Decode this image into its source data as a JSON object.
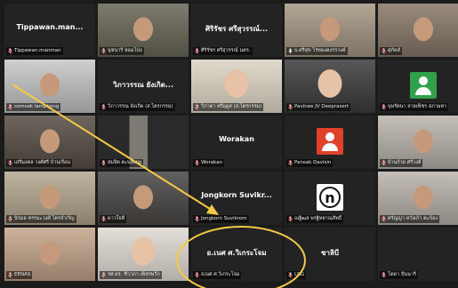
{
  "meeting": {
    "tiles": [
      {
        "row": 0,
        "col": 0,
        "center": "Tippawan.man...",
        "label": "Tippawan.manman",
        "mic": "muted",
        "bg": "#232323"
      },
      {
        "row": 0,
        "col": 1,
        "center": "",
        "label": "นุชนารี หอมโป่ง",
        "mic": "muted",
        "bg": "#6b6a5a",
        "video": "video"
      },
      {
        "row": 0,
        "col": 2,
        "center": "ศิริรัชร ศรีสุวรรณ์...",
        "label": "ศิริรัชร ศรีสุวรรณ์ นตร.",
        "mic": "muted",
        "bg": "#232323"
      },
      {
        "row": 0,
        "col": 3,
        "center": "",
        "label": "บ.ศรีสุข ไร่ทองคงรรวงค์",
        "mic": "on",
        "bg": "#a89a86",
        "video": "video",
        "active": true
      },
      {
        "row": 0,
        "col": 4,
        "center": "",
        "label": "ศุภิตส์",
        "mic": "muted",
        "bg": "#8a7b6c",
        "video": "video"
      },
      {
        "row": 1,
        "col": 0,
        "center": "",
        "label": "somsak lamphong",
        "mic": "muted",
        "bg": "#c9c9c9",
        "video": "video"
      },
      {
        "row": 1,
        "col": 1,
        "center": "วิภาวรรณ ยังเกิด...",
        "label": "วิภาวรรณ ยังเกิด (ส.ไตรกรรม)",
        "mic": "muted",
        "bg": "#232323"
      },
      {
        "row": 1,
        "col": 2,
        "center": "",
        "label": "วิภาดา ศรีอุดูส (ส.ไตรกรรม)",
        "mic": "muted",
        "bg": "#dcd4c4",
        "video": "photo"
      },
      {
        "row": 1,
        "col": 3,
        "center": "",
        "label": "Pavinee JV Deeprasert",
        "mic": "muted",
        "bg": "#3b3a3a",
        "video": "photo"
      },
      {
        "row": 1,
        "col": 4,
        "center": "",
        "label": "บุษรัตนา สายเพ็ชร สภามหา",
        "mic": "muted",
        "bg": "#232323",
        "avatar": "#2fa14a"
      },
      {
        "row": 2,
        "col": 0,
        "center": "",
        "label": "เสรีมงคล วงศ์ศรี บ้านเรือน",
        "mic": "muted",
        "bg": "#5a5148",
        "video": "video"
      },
      {
        "row": 2,
        "col": 1,
        "center": "",
        "label": "สมจิต ตะบองยม",
        "mic": "muted",
        "bg": "#2c2c2c",
        "video": "dim"
      },
      {
        "row": 2,
        "col": 2,
        "center": "Worakan",
        "label": "Worakan",
        "mic": "muted",
        "bg": "#232323"
      },
      {
        "row": 2,
        "col": 3,
        "center": "",
        "label": "Pansak Davisin",
        "mic": "muted",
        "bg": "#232323",
        "avatar": "#e0412b"
      },
      {
        "row": 2,
        "col": 4,
        "center": "",
        "label": "บ้านก้วย ศรีวงศ์",
        "mic": "muted",
        "bg": "#bdb7b0",
        "video": "video"
      },
      {
        "row": 3,
        "col": 0,
        "center": "",
        "label": "นิรมล หรรมะวงศ์ ไตรจำเริญ",
        "mic": "muted",
        "bg": "#b7aa92",
        "video": "video"
      },
      {
        "row": 3,
        "col": 1,
        "center": "",
        "label": "ดาวใจดี",
        "mic": "muted",
        "bg": "#4c4a48",
        "video": "video"
      },
      {
        "row": 3,
        "col": 2,
        "center": "Jongkorn Suvikr...",
        "label": "Jongkorn Suvikrom",
        "mic": "muted",
        "bg": "#232323"
      },
      {
        "row": 3,
        "col": 3,
        "center": "",
        "label": "ณฐิฒล พรฐิทยาณสิทธิ์",
        "mic": "muted",
        "bg": "#232323",
        "letter": "n"
      },
      {
        "row": 3,
        "col": 4,
        "center": "",
        "label": "ศรัญญา หวังเก้า ตะบ้อง",
        "mic": "muted",
        "bg": "#bcb5ae",
        "video": "video"
      },
      {
        "row": 4,
        "col": 0,
        "center": "",
        "label": "EENAS",
        "mic": "muted",
        "bg": "#c7a88e",
        "video": "video"
      },
      {
        "row": 4,
        "col": 1,
        "center": "",
        "label": "รศ.ดร. ชีวาภา เพ็ชรพวีก",
        "mic": "muted",
        "bg": "#dfd8d2",
        "video": "photo"
      },
      {
        "row": 4,
        "col": 2,
        "center": "อ.เนศ ศ.วิเกระโจม",
        "label": "ธเนศ ศ.วิเกระโจม",
        "mic": "muted",
        "bg": "#232323"
      },
      {
        "row": 4,
        "col": 3,
        "center": "ชาลิบี",
        "label": "LRG",
        "mic": "muted",
        "bg": "#232323"
      },
      {
        "row": 4,
        "col": 4,
        "center": "",
        "label": "โตดา ปันนาริ",
        "mic": "muted",
        "bg": "#232323"
      }
    ]
  },
  "annotation": {
    "color": "#f6c945"
  }
}
